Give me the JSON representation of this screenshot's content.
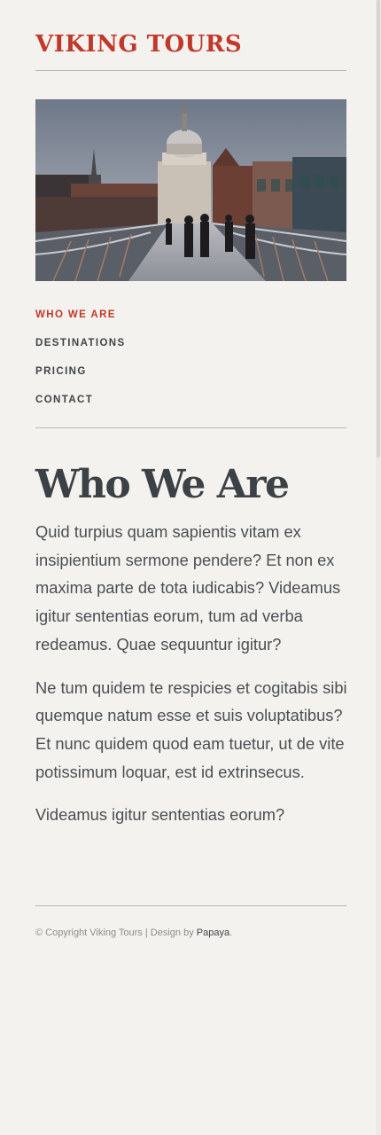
{
  "site": {
    "logo": "VIKING TOURS"
  },
  "hero": {
    "alt": "City bridge leading to a domed cathedral"
  },
  "nav": {
    "items": [
      {
        "label": "WHO WE ARE",
        "active": true
      },
      {
        "label": "DESTINATIONS",
        "active": false
      },
      {
        "label": "PRICING",
        "active": false
      },
      {
        "label": "CONTACT",
        "active": false
      }
    ]
  },
  "page": {
    "title": "Who We Are",
    "paragraphs": [
      "Quid turpius quam sapientis vitam ex insipientium sermone pendere? Et non ex maxima parte de tota iudicabis? Videamus igitur sententias eorum, tum ad verba redeamus. Quae sequuntur igitur?",
      "Ne tum quidem te respicies et cogitabis sibi quemque natum esse et suis voluptatibus? Et nunc quidem quod eam tuetur, ut de vite potissimum loquar, est id extrinsecus.",
      "Videamus igitur sententias eorum?"
    ]
  },
  "footer": {
    "copyright": "© Copyright Viking Tours | Design by ",
    "designer": "Papaya",
    "period": "."
  },
  "colors": {
    "accent": "#c0392b",
    "text": "#3f4447",
    "background": "#f4f2ef"
  }
}
